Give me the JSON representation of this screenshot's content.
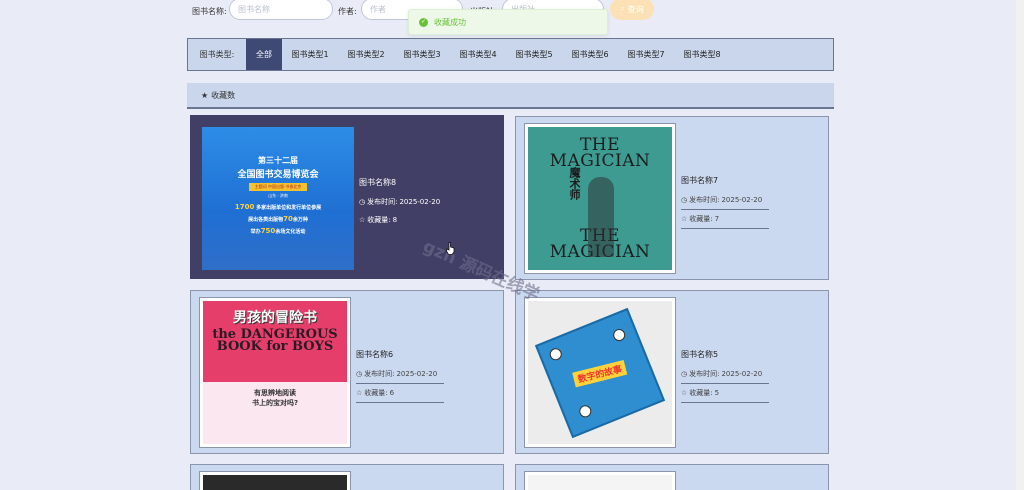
{
  "search": {
    "name_label": "图书名称:",
    "name_placeholder": "图书名称",
    "author_label": "作者:",
    "author_placeholder": "作者",
    "third_label": "出版社:",
    "third_placeholder": "出版社",
    "button_label": "查询"
  },
  "toast": {
    "text": "收藏成功",
    "color": "#67c23a"
  },
  "categories": {
    "label": "图书类型:",
    "items": [
      "全部",
      "图书类型1",
      "图书类型2",
      "图书类型3",
      "图书类型4",
      "图书类型5",
      "图书类型6",
      "图书类型7",
      "图书类型8"
    ],
    "active_index": 0
  },
  "section": {
    "title": "收藏数",
    "icon": "star-icon"
  },
  "cards": [
    {
      "title": "图书名称8",
      "date_label": "发布时间:",
      "date": "2025-02-20",
      "fav_label": "收藏量:",
      "fav": "8",
      "cover": {
        "line1": "第三十二届",
        "line2": "全国图书交易博览会",
        "band": "主题词 中国出版·书香北京",
        "loc": "山东 · 济南",
        "s1a": "1700",
        "s1b": "多家出版单位和发行单位参展",
        "s2a": "展出各类出版物",
        "s2b": "70",
        "s2c": "余万种",
        "s3a": "举办",
        "s3b": "750",
        "s3c": "余场文化活动"
      }
    },
    {
      "title": "图书名称7",
      "date_label": "发布时间:",
      "date": "2025-02-20",
      "fav_label": "收藏量:",
      "fav": "7",
      "cover": {
        "en_top": "THE MAGICIAN",
        "cn": "魔术师",
        "en_bottom": "THE MAGICIAN"
      }
    },
    {
      "title": "图书名称6",
      "date_label": "发布时间:",
      "date": "2025-02-20",
      "fav_label": "收藏量:",
      "fav": "6",
      "cover": {
        "cn": "男孩的冒险书",
        "en": "the DANGEROUS BOOK for BOYS",
        "foot1": "有思辨地阅读",
        "foot2": "书上的宝对吗?"
      }
    },
    {
      "title": "图书名称5",
      "date_label": "发布时间:",
      "date": "2025-02-20",
      "fav_label": "收藏量:",
      "fav": "5",
      "cover": {
        "cn": "数字的故事"
      }
    }
  ],
  "watermark": "gzh 源码在线学"
}
